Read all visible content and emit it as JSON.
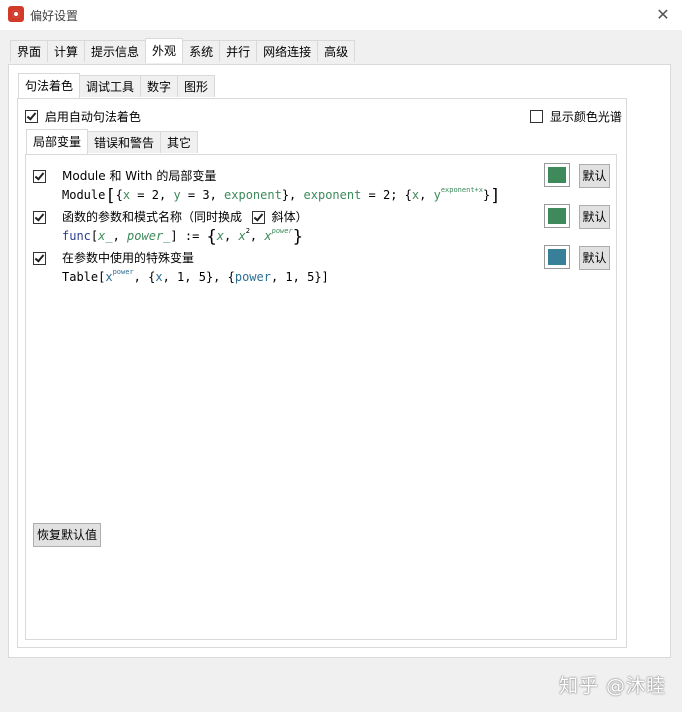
{
  "window": {
    "title": "偏好设置",
    "close_symbol": "✕"
  },
  "main_tabs": [
    "界面",
    "计算",
    "提示信息",
    "外观",
    "系统",
    "并行",
    "网络连接",
    "高级"
  ],
  "main_active_tab": "外观",
  "sub_tabs": [
    "句法着色",
    "调试工具",
    "数字",
    "图形"
  ],
  "sub_active_tab": "句法着色",
  "enable_syntax_coloring": {
    "label": "启用自动句法着色",
    "checked": true
  },
  "show_color_spectrum": {
    "label": "显示颜色光谱",
    "checked": false
  },
  "inner_tabs": [
    "局部变量",
    "错误和警告",
    "其它"
  ],
  "inner_active_tab": "局部变量",
  "options": [
    {
      "label": "Module 和 With 的局部变量",
      "checked": true,
      "color": "#3e8a5a",
      "default_label": "默认",
      "code": {
        "head": "Module",
        "bracket_open": "[",
        "brace_open": "{",
        "x": "x",
        "eq2": " = 2, ",
        "y": "y",
        "eq3": " = 3, ",
        "exponent1": "exponent",
        "brace_close": "}, ",
        "exponent2": "exponent",
        "eq2b": " = 2; {",
        "x2": "x",
        "comma": ", ",
        "y2": "y",
        "sup": "exponent+x",
        "tail": "}",
        "bracket_close": "]"
      }
    },
    {
      "label": "函数的参数和模式名称（同时换成",
      "italic_label": "斜体）",
      "italic_checked": true,
      "checked": true,
      "color": "#3e8a5a",
      "default_label": "默认",
      "code": {
        "head": "func",
        "bracket_open": "[",
        "x_": "x_",
        "comma1": ", ",
        "power_": "power_",
        "assign": "] := ",
        "brace_open": "{",
        "x1": "x",
        "comma2": ", ",
        "x2": "x",
        "sup2": "2",
        "comma3": ", ",
        "x3": "x",
        "sup_power": "power",
        "brace_close": "}"
      }
    },
    {
      "label": "在参数中使用的特殊变量",
      "checked": true,
      "color": "#3a7f9a",
      "default_label": "默认",
      "code": {
        "head": "Table[",
        "x1": "x",
        "sup_power": "power",
        "mid1": ", {",
        "x2": "x",
        "mid2": ", 1, 5}, {",
        "power": "power",
        "tail": ", 1, 5}]"
      }
    }
  ],
  "restore_defaults_label": "恢复默认值",
  "watermark": "知乎 @沐睦"
}
